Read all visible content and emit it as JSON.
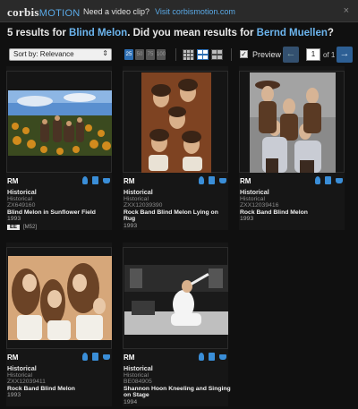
{
  "header": {
    "logo_main": "corbis",
    "logo_sub": "MOTION",
    "promo_text": "Need a video clip?",
    "promo_link": "Visit corbismotion.com",
    "close_glyph": "×"
  },
  "results": {
    "lead": "5 results for",
    "query": "Blind Melon",
    "suggest_text": ". Did you mean results for",
    "suggestion": "Bernd Muellen",
    "tail": "?"
  },
  "toolbar": {
    "sort_label": "Sort by: Relevance",
    "per_page": [
      "25",
      "50",
      "75",
      "100"
    ],
    "preview_label": "Preview",
    "preview_checked": true,
    "page_value": "1",
    "of_label": "of 1",
    "prev_glyph": "←",
    "next_glyph": "→"
  },
  "cards": [
    {
      "license": "RM",
      "collection": "Historical",
      "sub": "Historical",
      "id": "ZX649160",
      "title": "Blind Melon in Sunflower Field",
      "year": "1993",
      "badge": "EE",
      "badge_text": "[M52]"
    },
    {
      "license": "RM",
      "collection": "Historical",
      "sub": "Historical",
      "id": "ZXX12039390",
      "title": "Rock Band Blind Melon Lying on Rug",
      "year": "1993"
    },
    {
      "license": "RM",
      "collection": "Historical",
      "sub": "Historical",
      "id": "ZXX12039416",
      "title": "Rock Band Blind Melon",
      "year": "1993"
    },
    {
      "license": "RM",
      "collection": "Historical",
      "sub": "Historical",
      "id": "ZXX12039411",
      "title": "Rock Band Blind Melon",
      "year": "1993"
    },
    {
      "license": "RM",
      "collection": "Historical",
      "sub": "Historical",
      "id": "BE084905",
      "title": "Shannon Hoon Kneeling and Singing on Stage",
      "year": "1994"
    }
  ],
  "colors": {
    "accent": "#5aa9e6",
    "button": "#2d6fb4",
    "bg": "#101010"
  }
}
